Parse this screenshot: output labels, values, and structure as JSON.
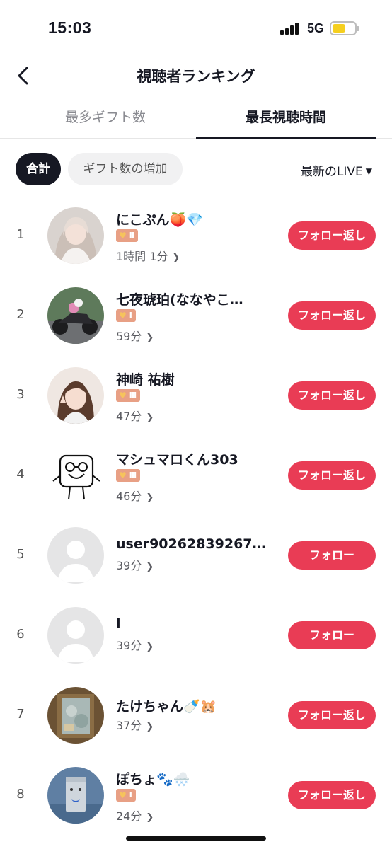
{
  "status": {
    "time": "15:03",
    "network": "5G"
  },
  "header": {
    "title": "視聴者ランキング"
  },
  "tabs": [
    {
      "label": "最多ギフト数"
    },
    {
      "label": "最長視聴時間"
    }
  ],
  "filters": {
    "chips": [
      {
        "label": "合計"
      },
      {
        "label": "ギフト数の増加"
      }
    ],
    "sort_label": "最新のLIVE"
  },
  "colors": {
    "accent": "#e93c55",
    "badge": "#e8a085",
    "text": "#161823"
  },
  "viewers": [
    {
      "rank": "1",
      "name": "にこぷん🍑💎",
      "badge": "Ⅱ",
      "duration": "1時間 1分",
      "action": "フォロー返し"
    },
    {
      "rank": "2",
      "name": "七夜琥珀(ななやこ…",
      "badge": "Ⅰ",
      "duration": "59分",
      "action": "フォロー返し"
    },
    {
      "rank": "3",
      "name": "神崎 祐樹",
      "badge": "Ⅲ",
      "duration": "47分",
      "action": "フォロー返し"
    },
    {
      "rank": "4",
      "name": "マシュマロくん303",
      "badge": "Ⅲ",
      "duration": "46分",
      "action": "フォロー返し"
    },
    {
      "rank": "5",
      "name": "user90262839267…",
      "badge": "",
      "duration": "39分",
      "action": "フォロー"
    },
    {
      "rank": "6",
      "name": "l",
      "badge": "",
      "duration": "39分",
      "action": "フォロー"
    },
    {
      "rank": "7",
      "name": "たけちゃん🍼🐹",
      "badge": "",
      "duration": "37分",
      "action": "フォロー返し"
    },
    {
      "rank": "8",
      "name": "ぽちょ🐾🌨️",
      "badge": "Ⅰ",
      "duration": "24分",
      "action": "フォロー返し"
    }
  ]
}
